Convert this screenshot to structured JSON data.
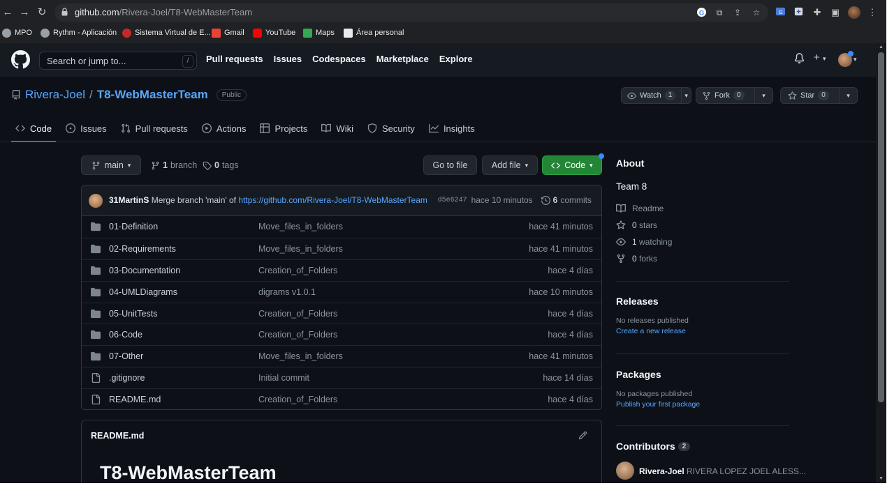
{
  "browser": {
    "url_host": "github.com",
    "url_path": "/Rivera-Joel/T8-WebMasterTeam",
    "bookmarks": [
      {
        "label": "MPO",
        "color": "#9aa0a6"
      },
      {
        "label": "Rythm - Aplicación",
        "color": "#9aa0a6"
      },
      {
        "label": "Sistema Virtual de E...",
        "color": "#c62828"
      },
      {
        "label": "Gmail",
        "color": "#ea4335"
      },
      {
        "label": "YouTube",
        "color": "#ff0000"
      },
      {
        "label": "Maps",
        "color": "#34a853"
      },
      {
        "label": "Área personal",
        "color": "#e8eaed"
      }
    ]
  },
  "header": {
    "search_placeholder": "Search or jump to...",
    "search_key": "/",
    "nav": [
      "Pull requests",
      "Issues",
      "Codespaces",
      "Marketplace",
      "Explore"
    ]
  },
  "repo": {
    "owner": "Rivera-Joel",
    "separator": "/",
    "name": "T8-WebMasterTeam",
    "visibility": "Public",
    "watch_label": "Watch",
    "watch_count": "1",
    "fork_label": "Fork",
    "fork_count": "0",
    "star_label": "Star",
    "star_count": "0"
  },
  "tabs": [
    {
      "label": "Code",
      "icon": "code-icon"
    },
    {
      "label": "Issues",
      "icon": "issue-icon"
    },
    {
      "label": "Pull requests",
      "icon": "pull-request-icon"
    },
    {
      "label": "Actions",
      "icon": "play-icon"
    },
    {
      "label": "Projects",
      "icon": "table-icon"
    },
    {
      "label": "Wiki",
      "icon": "book-icon"
    },
    {
      "label": "Security",
      "icon": "shield-icon"
    },
    {
      "label": "Insights",
      "icon": "graph-icon"
    }
  ],
  "filenav": {
    "branch": "main",
    "branch_count": "1",
    "branch_word": "branch",
    "tag_count": "0",
    "tag_word": "tags",
    "go_to_file": "Go to file",
    "add_file": "Add file",
    "code": "Code"
  },
  "commit": {
    "author": "31MartinS",
    "message": "Merge branch 'main' of",
    "link": "https://github.com/Rivera-Joel/T8-WebMasterTeam",
    "sha": "d5e6247",
    "time": "hace 10 minutos",
    "commit_count": "6",
    "commit_word": "commits"
  },
  "files": [
    {
      "name": "01-Definition",
      "message": "Move_files_in_folders",
      "age": "hace 41 minutos",
      "type": "dir"
    },
    {
      "name": "02-Requirements",
      "message": "Move_files_in_folders",
      "age": "hace 41 minutos",
      "type": "dir"
    },
    {
      "name": "03-Documentation",
      "message": "Creation_of_Folders",
      "age": "hace 4 días",
      "type": "dir"
    },
    {
      "name": "04-UMLDiagrams",
      "message": "digrams v1.0.1",
      "age": "hace 10 minutos",
      "type": "dir"
    },
    {
      "name": "05-UnitTests",
      "message": "Creation_of_Folders",
      "age": "hace 4 días",
      "type": "dir"
    },
    {
      "name": "06-Code",
      "message": "Creation_of_Folders",
      "age": "hace 4 días",
      "type": "dir"
    },
    {
      "name": "07-Other",
      "message": "Move_files_in_folders",
      "age": "hace 41 minutos",
      "type": "dir"
    },
    {
      "name": ".gitignore",
      "message": "Initial commit",
      "age": "hace 14 días",
      "type": "file"
    },
    {
      "name": "README.md",
      "message": "Creation_of_Folders",
      "age": "hace 4 días",
      "type": "file"
    }
  ],
  "readme": {
    "filename": "README.md",
    "heading": "T8-WebMasterTeam"
  },
  "sidebar": {
    "about_title": "About",
    "description": "Team 8",
    "readme_label": "Readme",
    "stars_count": "0",
    "stars_word": "stars",
    "watching_count": "1",
    "watching_word": "watching",
    "forks_count": "0",
    "forks_word": "forks",
    "releases_title": "Releases",
    "releases_empty": "No releases published",
    "releases_link": "Create a new release",
    "packages_title": "Packages",
    "packages_empty": "No packages published",
    "packages_link": "Publish your first package",
    "contributors_title": "Contributors",
    "contributors_count": "2",
    "contributor_login": "Rivera-Joel",
    "contributor_name": "RIVERA LOPEZ JOEL ALESS..."
  },
  "colors": {
    "background": "#0d1117",
    "header": "#161b22",
    "link": "#58a6ff",
    "accent_tab": "#f78166",
    "code_button": "#238636"
  }
}
